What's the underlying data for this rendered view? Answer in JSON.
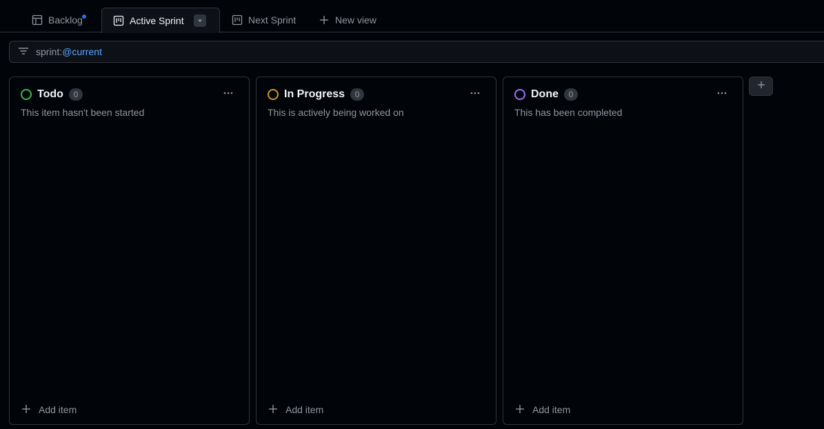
{
  "tabs": [
    {
      "label": "Backlog",
      "icon": "table-icon",
      "has_notification_dot": true
    },
    {
      "label": "Active Sprint",
      "icon": "board-icon",
      "active": true
    },
    {
      "label": "Next Sprint",
      "icon": "board-icon"
    },
    {
      "label": "New view",
      "icon": "plus-icon"
    }
  ],
  "filter": {
    "key": "sprint:",
    "value": "@current"
  },
  "columns": [
    {
      "title": "Todo",
      "count": "0",
      "description": "This item hasn't been started",
      "add_label": "Add item",
      "status_color": "#3fb950"
    },
    {
      "title": "In Progress",
      "count": "0",
      "description": "This is actively being worked on",
      "add_label": "Add item",
      "status_color": "#d29922"
    },
    {
      "title": "Done",
      "count": "0",
      "description": "This has been completed",
      "add_label": "Add item",
      "status_color": "#a371f7"
    }
  ],
  "colors": {
    "accent": "#58a6ff",
    "notification": "#2f6feb"
  }
}
